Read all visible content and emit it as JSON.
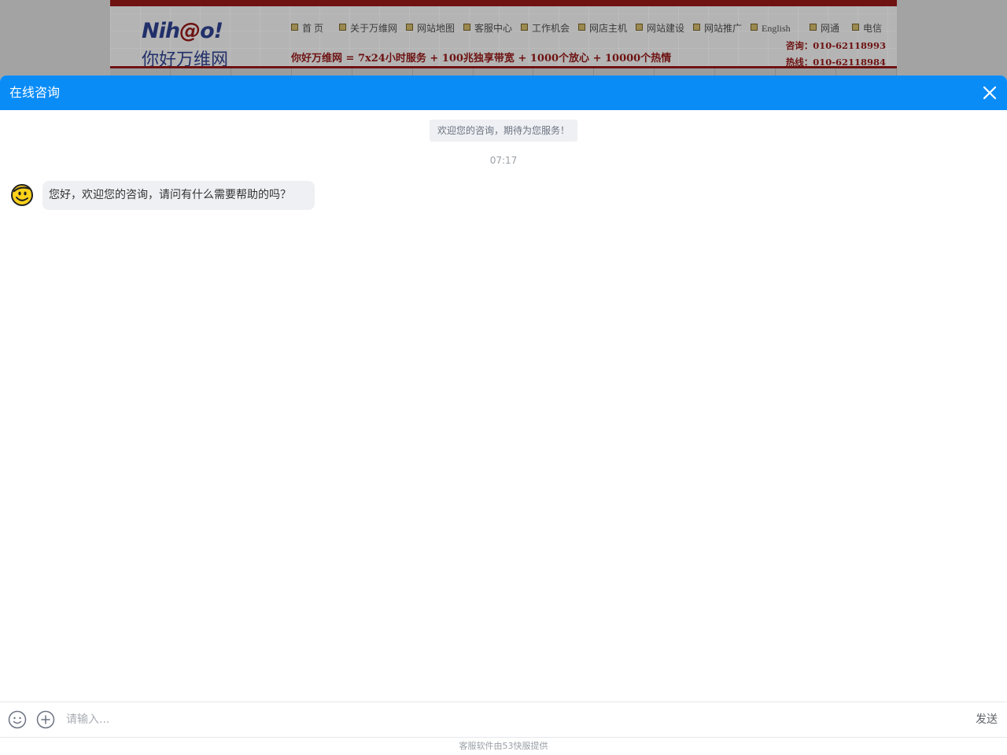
{
  "site": {
    "logo_en_a": "Nih",
    "logo_en_at": "@",
    "logo_en_b": "o!",
    "logo_cn": "你好万维网",
    "nav": [
      "首 页",
      "关于万维网",
      "网站地图",
      "客服中心",
      "工作机会",
      "网店主机",
      "网站建设",
      "网站推广",
      "English",
      "网通",
      "电信"
    ],
    "slogan": "你好万维网 = 7x24小时服务 + 100兆独享带宽 + 1000个放心 + 10000个热情",
    "consult": "咨询：010-62118993",
    "hotline": "热线：010-62118984"
  },
  "chat": {
    "title": "在线咨询",
    "system_message": "欢迎您的咨询，期待为您服务！",
    "timestamp": "07:17",
    "agent_message": "您好，欢迎您的咨询，请问有什么需要帮助的吗？",
    "input_placeholder": "请输入...",
    "send_label": "发送",
    "footer": "客服软件由53快服提供"
  },
  "colors": {
    "header": "#0a8cf7",
    "bubble": "#eef0f3",
    "site_accent": "#6e1212"
  },
  "icons": {
    "close": "close-icon",
    "avatar": "smiley-avatar-icon",
    "emoji": "emoji-icon",
    "plus": "plus-circle-icon"
  }
}
